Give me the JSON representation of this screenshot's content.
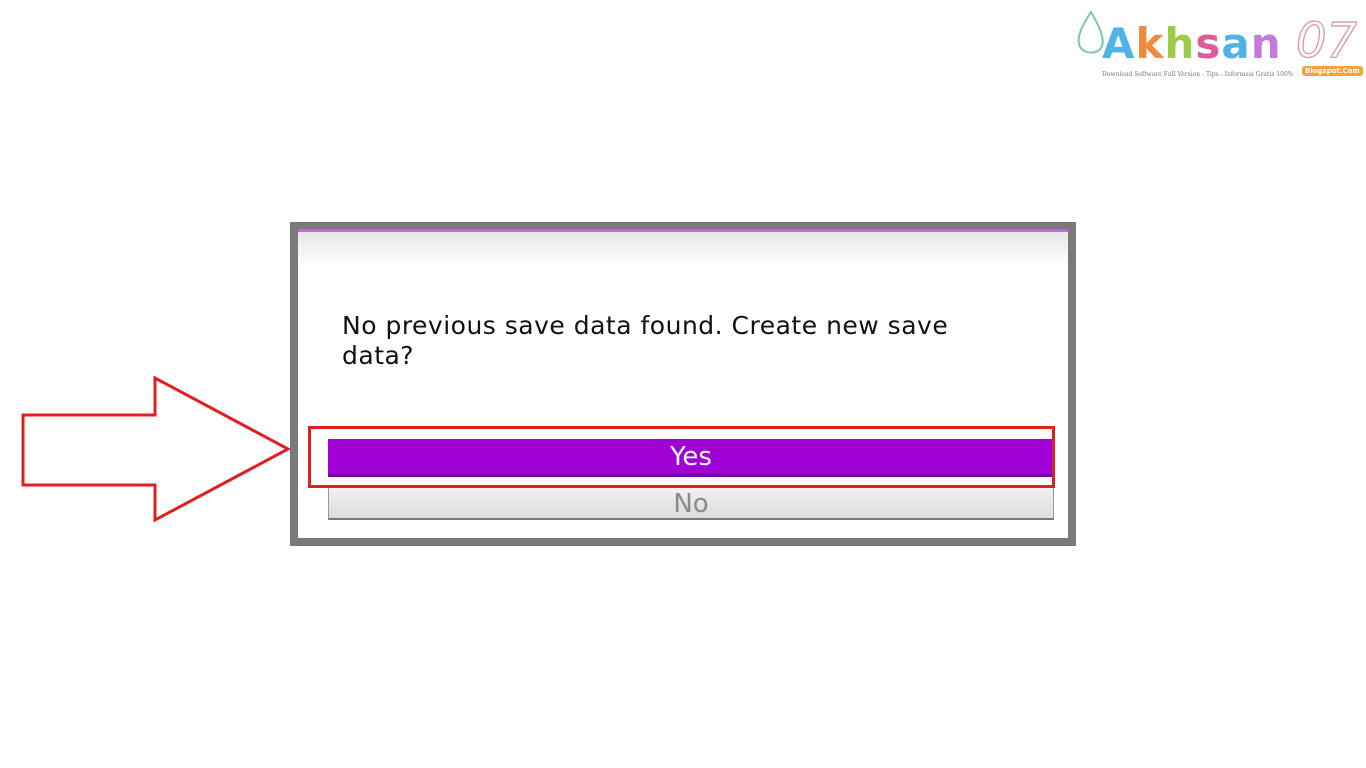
{
  "watermark": {
    "brand_letters": [
      "A",
      "k",
      "h",
      "s",
      "a",
      "n"
    ],
    "brand_number": "07",
    "tagline": "Download Software Full Version - Tips - Informasi Gratis 100%",
    "badge": "Blogspot.Com"
  },
  "annotation": {
    "arrow_color": "#e02020",
    "highlight_color": "#e02020"
  },
  "dialog": {
    "message": "No previous save data found. Create new save data?",
    "yes_label": "Yes",
    "no_label": "No",
    "accent_color": "#a000d4"
  }
}
